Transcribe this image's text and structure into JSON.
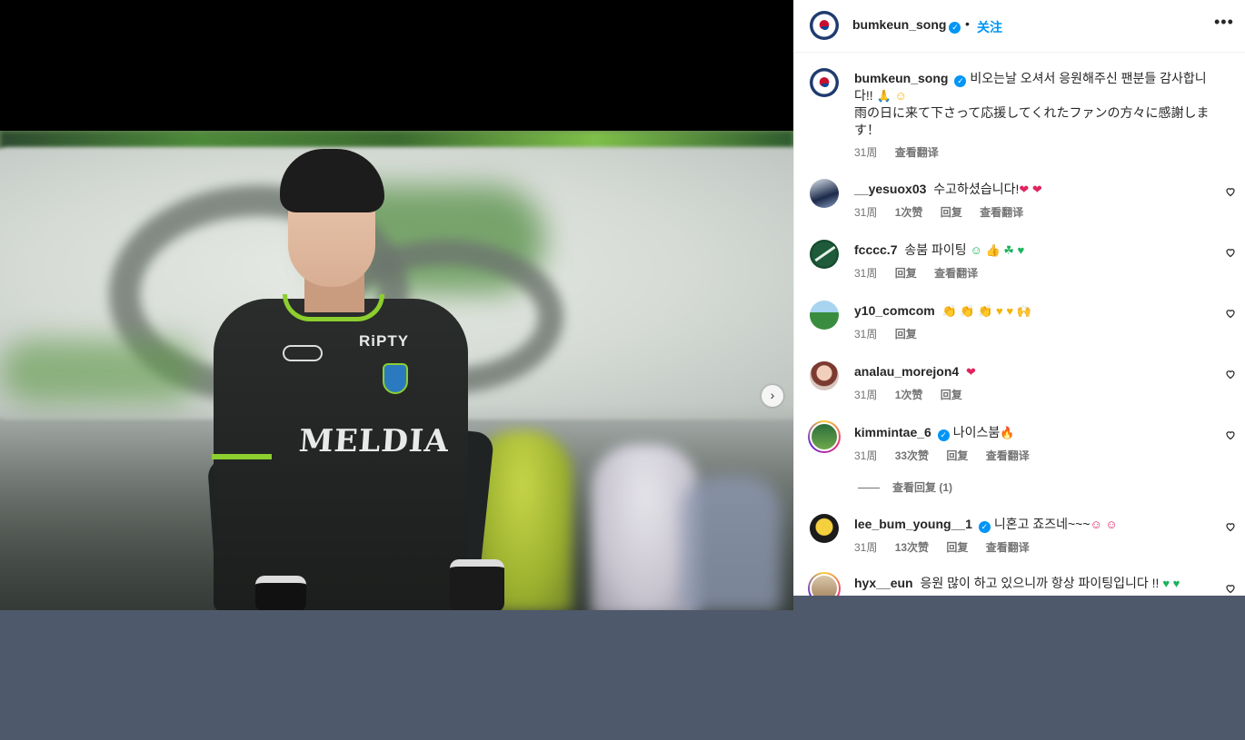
{
  "post": {
    "author": "bumkeun_song",
    "follow_label": "关注",
    "dot": "•",
    "caption_line1": "비오는날 오셔서 응원해주신 팬분들 감사합니다!! ",
    "caption_line2": "雨の日に来て下さって応援してくれたファンの方々に感謝します！",
    "caption_time": "31周",
    "caption_translate": "查看翻译",
    "photo": {
      "jersey_brand": "RiPTY",
      "jersey_sponsor": "MELDIA"
    }
  },
  "icons": {
    "more": "more-horizontal-icon",
    "next": "chevron-right-icon",
    "verified": "verified-badge-icon",
    "heart": "heart-outline-icon"
  },
  "comments": [
    {
      "user": "__yesuox03",
      "verified": false,
      "text": "수고하셨습니다!",
      "emoji": "❤ ❤",
      "time": "31周",
      "likes": "1次赞",
      "reply": "回复",
      "translate": "查看翻译"
    },
    {
      "user": "fcccc.7",
      "verified": false,
      "text": "송붐 파이팅",
      "emoji": "☺ 👍 ☘ ♥",
      "time": "31周",
      "likes": "",
      "reply": "回复",
      "translate": "查看翻译"
    },
    {
      "user": "y10_comcom",
      "verified": false,
      "text": "",
      "emoji": "👏 👏 👏 ♥ ♥ 🙌",
      "time": "31周",
      "likes": "",
      "reply": "回复",
      "translate": ""
    },
    {
      "user": "analau_morejon4",
      "verified": false,
      "text": "",
      "emoji": "❤",
      "time": "31周",
      "likes": "1次赞",
      "reply": "回复",
      "translate": ""
    },
    {
      "user": "kimmintae_6",
      "verified": true,
      "text": "나이스붐",
      "emoji": "🔥",
      "time": "31周",
      "likes": "33次赞",
      "reply": "回复",
      "translate": "查看翻译"
    },
    {
      "user": "lee_bum_young__1",
      "verified": true,
      "text": "니혼고 죠즈네~~~",
      "emoji": "☺ ☺",
      "time": "31周",
      "likes": "13次赞",
      "reply": "回复",
      "translate": "查看翻译"
    },
    {
      "user": "hyx__eun",
      "verified": false,
      "text": "응원 많이 하고 있으니까 항상 파이팅입니다 !!",
      "emoji": "♥ ♥",
      "time": "",
      "likes": "",
      "reply": "",
      "translate": ""
    }
  ],
  "view_replies": "查看回复 (1)",
  "colors": {
    "accent": "#0095f6",
    "heart_red": "#e0245e",
    "backdrop": "#4e596b"
  }
}
